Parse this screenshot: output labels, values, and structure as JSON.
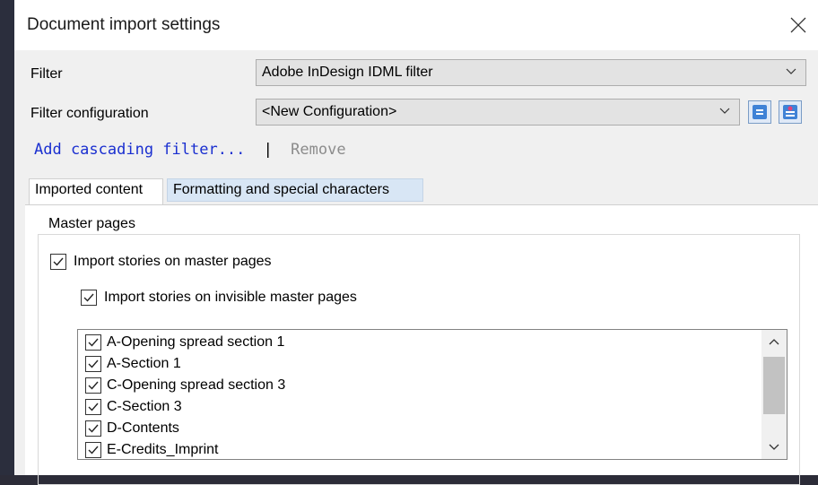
{
  "dialog": {
    "title": "Document import settings"
  },
  "filter": {
    "label": "Filter",
    "value": "Adobe InDesign IDML filter"
  },
  "filter_configuration": {
    "label": "Filter configuration",
    "value": "<New Configuration>"
  },
  "cascading": {
    "add_label": "Add cascading filter...",
    "separator": "|",
    "remove_label": "Remove"
  },
  "tabs": [
    {
      "label": "Imported content",
      "active": true
    },
    {
      "label": "Formatting and special characters",
      "active": false
    }
  ],
  "master_pages": {
    "group_title": "Master pages",
    "import_stories_label": "Import stories on master pages",
    "import_stories_checked": true,
    "import_invisible_label": "Import stories on invisible master pages",
    "import_invisible_checked": true,
    "list": [
      {
        "label": "A-Opening spread section 1",
        "checked": true
      },
      {
        "label": "A-Section 1",
        "checked": true
      },
      {
        "label": "C-Opening spread section 3",
        "checked": true
      },
      {
        "label": "C-Section 3",
        "checked": true
      },
      {
        "label": "D-Contents",
        "checked": true
      },
      {
        "label": "E-Credits_Imprint",
        "checked": true
      }
    ]
  },
  "colors": {
    "link": "#1a2fd0",
    "disabled_text": "#8c8c8c",
    "inactive_tab": "#d8e6f5"
  }
}
